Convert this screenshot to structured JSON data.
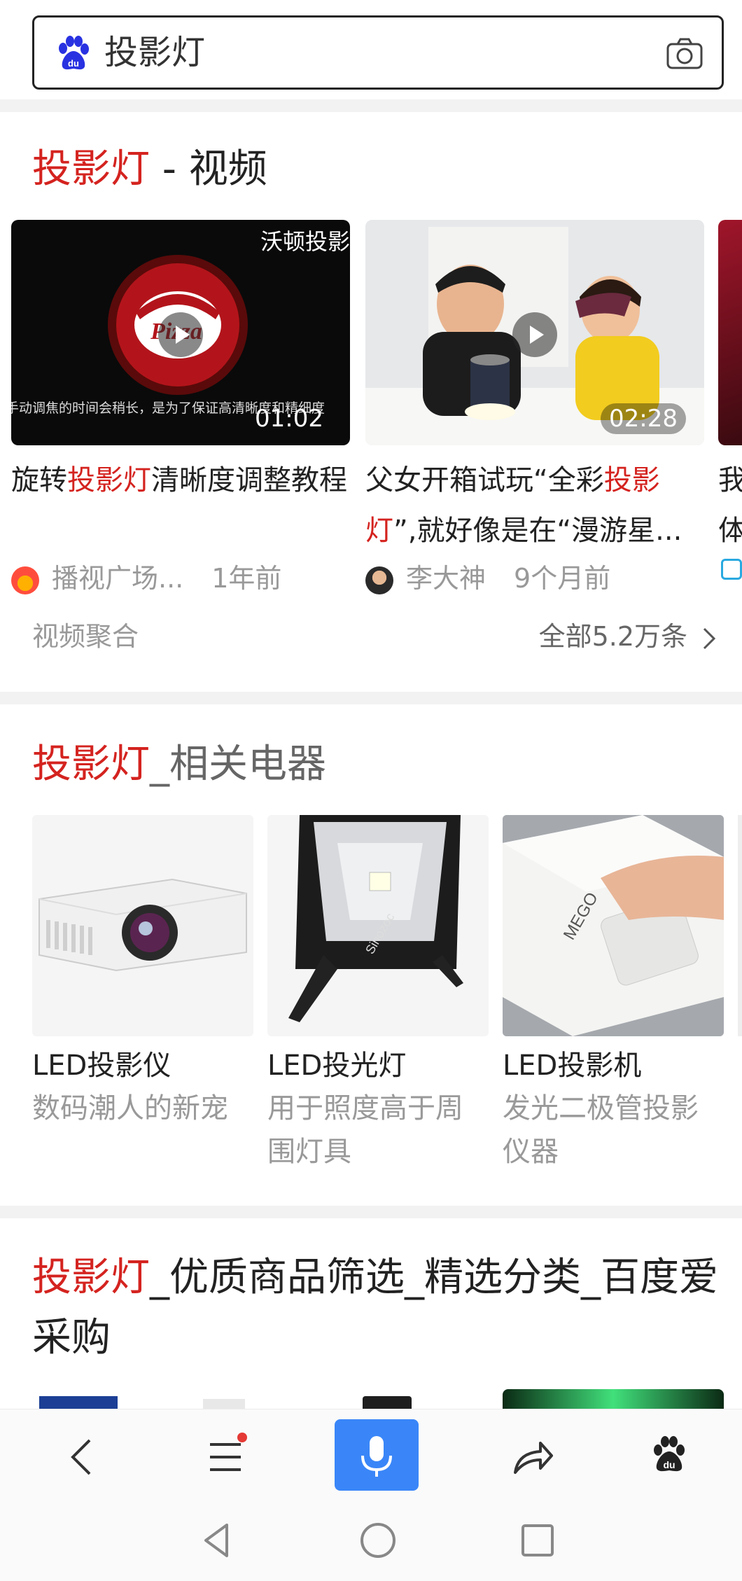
{
  "search": {
    "query": "投影灯"
  },
  "video_section": {
    "title_hl": "投影灯",
    "title_rest": " - 视频",
    "cards": [
      {
        "title_pre": "旋转",
        "title_hl": "投影灯",
        "title_post": "清晰度调整教程",
        "duration": "01:02",
        "thumb_caption": "沃顿投影",
        "thumb_subtitle": "手动调焦的时间会稍长，是为了保证高清晰度和精细度",
        "source": "播视广场...",
        "time": "1年前"
      },
      {
        "title_pre": "父女开箱试玩“全彩",
        "title_hl": "投影灯",
        "title_post": "”,就好像是在“漫游星...",
        "duration": "02:28",
        "source": "李大神",
        "time": "9个月前"
      },
      {
        "title_pre": "我",
        "title_line2": "体"
      }
    ],
    "footer_left": "视频聚合",
    "footer_right": "全部5.2万条"
  },
  "appliance_section": {
    "title_hl": "投影灯",
    "title_rest": "_相关电器",
    "items": [
      {
        "name": "LED投影仪",
        "desc": "数码潮人的新宠"
      },
      {
        "name": "LED投光灯",
        "desc": "用于照度高于周围灯具"
      },
      {
        "name": "LED投影机",
        "desc": "发光二极管投影仪器"
      }
    ]
  },
  "shopping_section": {
    "title_hl": "投影灯",
    "title_rest": "_优质商品筛选_精选分类_百度爱采购"
  },
  "colors": {
    "accent": "#d4231f",
    "mic": "#3a86f8",
    "notify_dot": "#e53935"
  }
}
